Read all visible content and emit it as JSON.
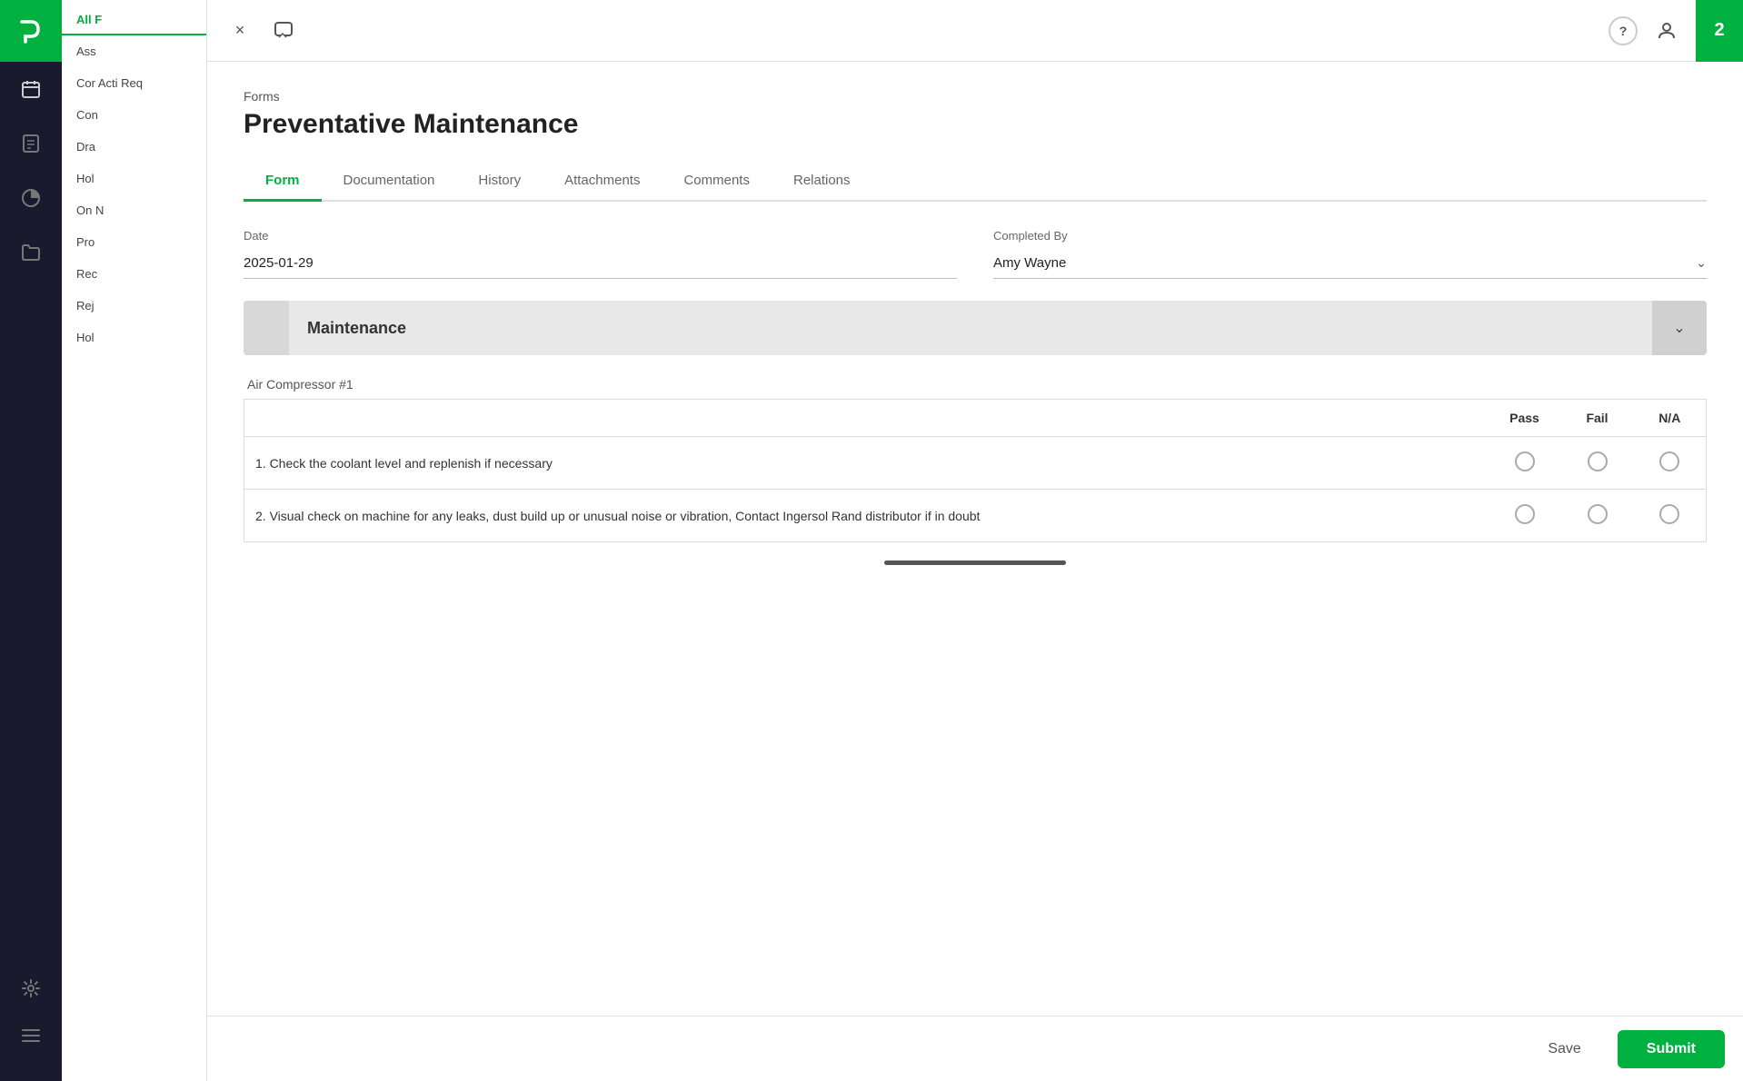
{
  "sidebar": {
    "logo_text": "P",
    "notification_count": "2",
    "icons": [
      {
        "name": "calendar-icon",
        "symbol": "📅"
      },
      {
        "name": "document-icon",
        "symbol": "📄"
      },
      {
        "name": "chart-icon",
        "symbol": "📊"
      },
      {
        "name": "folder-icon",
        "symbol": "📁"
      },
      {
        "name": "settings-icon",
        "symbol": "⚙"
      }
    ]
  },
  "left_panel": {
    "header": "All F",
    "items": [
      {
        "label": "Ass"
      },
      {
        "label": "Cor Acti Req"
      },
      {
        "label": "Con"
      },
      {
        "label": "Dra"
      },
      {
        "label": "Hol"
      },
      {
        "label": "On N"
      },
      {
        "label": "Pro"
      },
      {
        "label": "Rec"
      },
      {
        "label": "Rej"
      },
      {
        "label": "Hol"
      }
    ]
  },
  "topbar": {
    "close_label": "×",
    "help_label": "?",
    "notification_count": "2"
  },
  "breadcrumb": "Forms",
  "page_title": "Preventative Maintenance",
  "tabs": [
    {
      "label": "Form",
      "active": true
    },
    {
      "label": "Documentation"
    },
    {
      "label": "History"
    },
    {
      "label": "Attachments"
    },
    {
      "label": "Comments"
    },
    {
      "label": "Relations"
    }
  ],
  "form": {
    "date_label": "Date",
    "date_value": "2025-01-29",
    "completed_by_label": "Completed By",
    "completed_by_value": "Amy Wayne"
  },
  "section": {
    "title": "Maintenance"
  },
  "table": {
    "group_label": "Air Compressor #1",
    "columns": [
      "Pass",
      "Fail",
      "N/A"
    ],
    "rows": [
      {
        "description": "1. Check the coolant level and replenish if necessary"
      },
      {
        "description": "2. Visual check on machine for any leaks, dust build up or unusual noise or vibration, Contact Ingersol Rand distributor if in doubt"
      }
    ]
  },
  "bottom_bar": {
    "save_label": "Save",
    "submit_label": "Submit"
  }
}
